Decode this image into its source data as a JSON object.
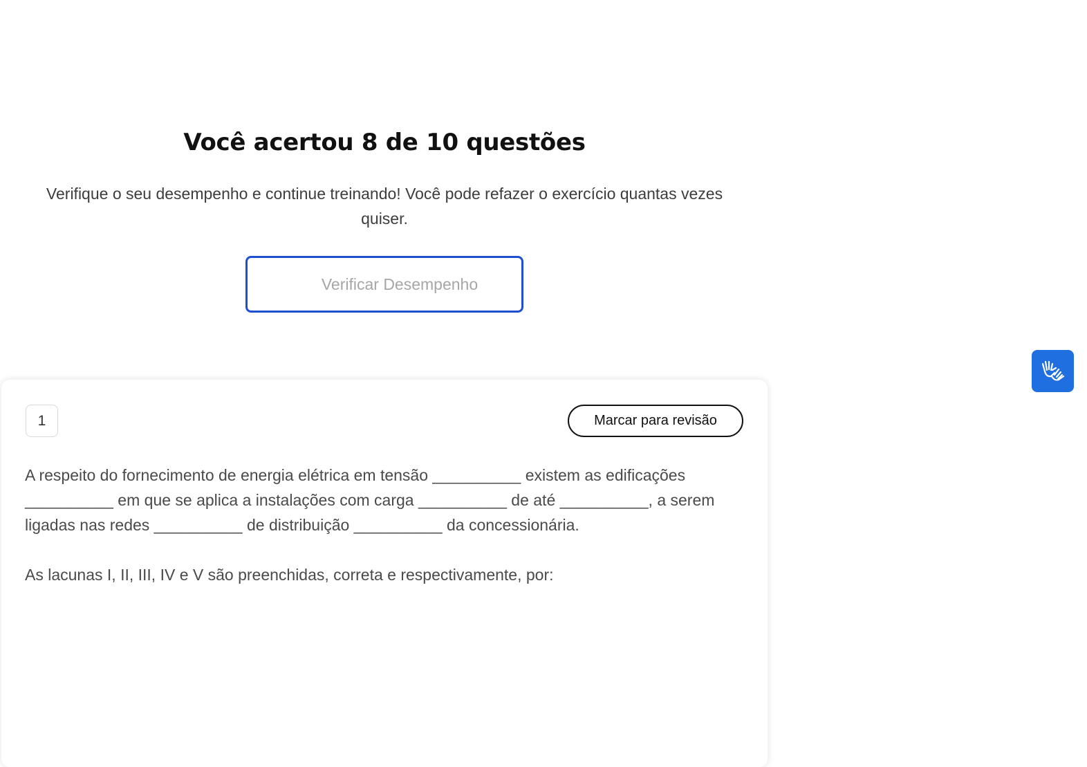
{
  "result": {
    "title": "Você acertou 8 de 10 questões",
    "subtitle": "Verifique o seu desempenho e continue treinando! Você pode refazer o exercício quantas vezes quiser.",
    "verify_button_label": "Verificar Desempenho"
  },
  "question": {
    "number": "1",
    "review_button_label": "Marcar para revisão",
    "statement": "A respeito do fornecimento de energia elétrica em tensão __________ existem as edificações __________ em que se aplica a instalações com carga __________ de até __________, a serem ligadas nas redes __________ de distribuição __________ da concessionária.",
    "prompt": "As lacunas I, II, III, IV e V são preenchidas, correta e respectivamente, por:"
  },
  "accessibility": {
    "icon": "sign-language-hands-icon",
    "color": "#1f6fe0"
  },
  "colors": {
    "accent": "#1f4fd1",
    "title": "#111111",
    "body_text": "#4a4a4a"
  }
}
